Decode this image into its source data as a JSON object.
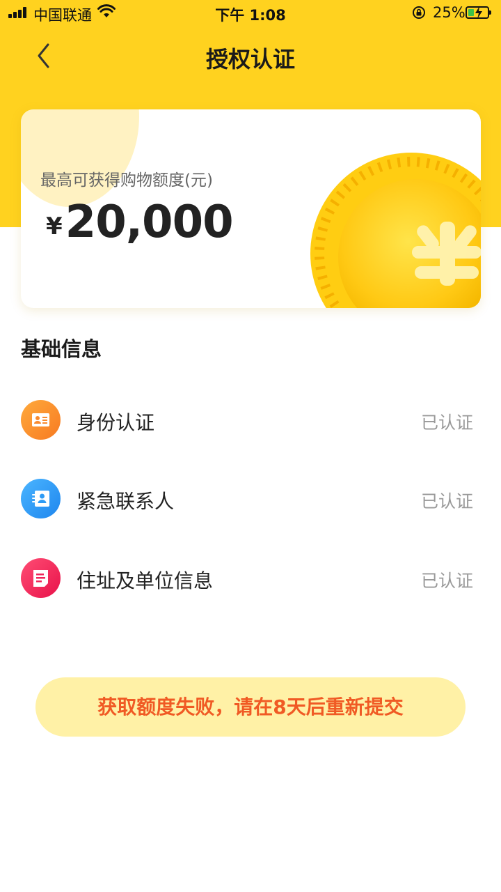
{
  "status_bar": {
    "carrier": "中国联通",
    "time": "下午 1:08",
    "battery_percent": "25%",
    "battery_level": 0.25
  },
  "nav": {
    "title": "授权认证",
    "back_icon": "chevron-left-icon"
  },
  "limit_card": {
    "label": "最高可获得购物额度(元)",
    "currency": "¥",
    "amount": "20,000",
    "decoration_icon": "yuan-coin-icon"
  },
  "basic_info": {
    "title": "基础信息",
    "items": [
      {
        "label": "身份认证",
        "status": "已认证",
        "icon": "id-card-icon",
        "color": "#F98A2E"
      },
      {
        "label": "紧急联系人",
        "status": "已认证",
        "icon": "contact-book-icon",
        "color": "#2E9BF5"
      },
      {
        "label": "住址及单位信息",
        "status": "已认证",
        "icon": "document-icon",
        "color": "#F0245A"
      }
    ]
  },
  "notice": {
    "text": "获取额度失败，请在8天后重新提交"
  },
  "colors": {
    "brand_yellow": "#FFD21F",
    "notice_bg": "#FFF1A6",
    "notice_text": "#F05A24"
  }
}
